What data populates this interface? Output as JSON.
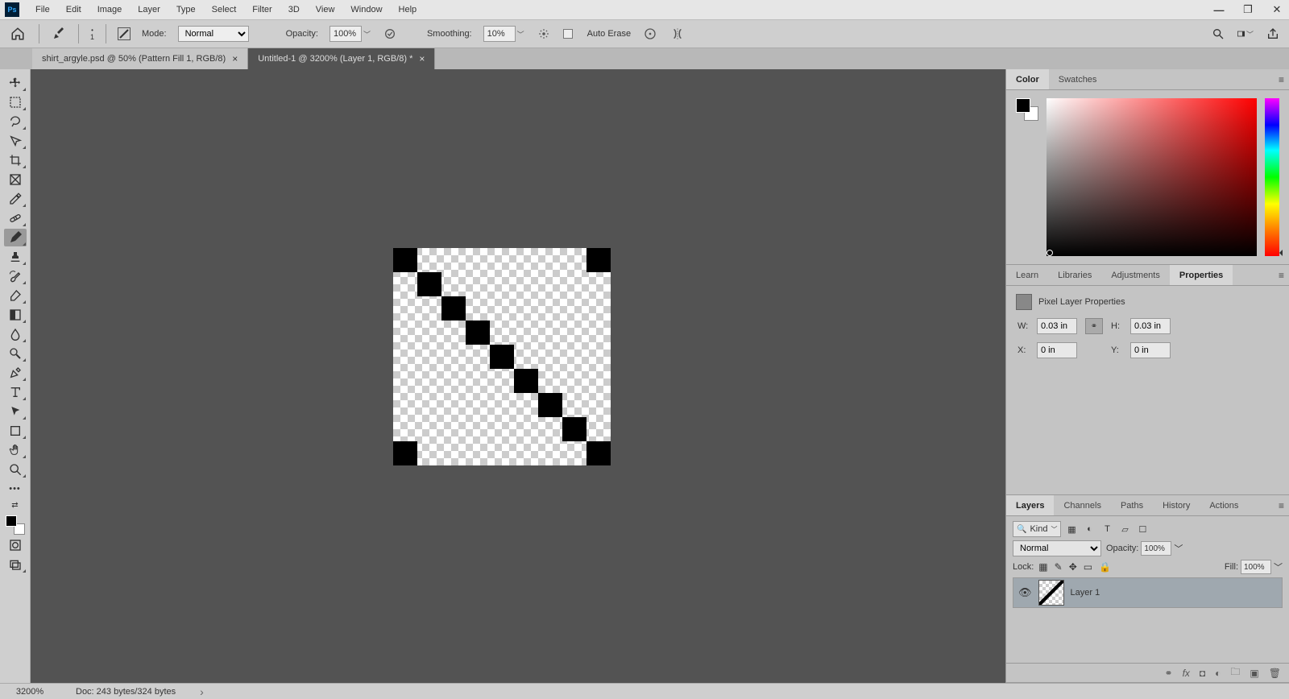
{
  "menubar": {
    "items": [
      "File",
      "Edit",
      "Image",
      "Layer",
      "Type",
      "Select",
      "Filter",
      "3D",
      "View",
      "Window",
      "Help"
    ]
  },
  "optionsbar": {
    "brush_size": "1",
    "mode_label": "Mode:",
    "mode_value": "Normal",
    "opacity_label": "Opacity:",
    "opacity_value": "100%",
    "smoothing_label": "Smoothing:",
    "smoothing_value": "10%",
    "auto_erase": "Auto Erase"
  },
  "doctabs": [
    {
      "title": "shirt_argyle.psd @ 50% (Pattern Fill 1, RGB/8)",
      "active": false
    },
    {
      "title": "Untitled-1 @ 3200% (Layer 1, RGB/8) *",
      "active": true
    }
  ],
  "panels": {
    "color": {
      "tabs": [
        "Color",
        "Swatches"
      ],
      "active": 0
    },
    "props": {
      "tabs": [
        "Learn",
        "Libraries",
        "Adjustments",
        "Properties"
      ],
      "active": 3,
      "header": "Pixel Layer Properties",
      "w_label": "W:",
      "w": "0.03 in",
      "h_label": "H:",
      "h": "0.03 in",
      "x_label": "X:",
      "x": "0 in",
      "y_label": "Y:",
      "y": "0 in"
    },
    "layers": {
      "tabs": [
        "Layers",
        "Channels",
        "Paths",
        "History",
        "Actions"
      ],
      "active": 0,
      "kind_label": "Kind",
      "blend_mode": "Normal",
      "opacity_label": "Opacity:",
      "opacity": "100%",
      "lock_label": "Lock:",
      "fill_label": "Fill:",
      "fill": "100%",
      "layer_name": "Layer 1"
    }
  },
  "statusbar": {
    "zoom": "3200%",
    "doc": "Doc: 243 bytes/324 bytes"
  }
}
